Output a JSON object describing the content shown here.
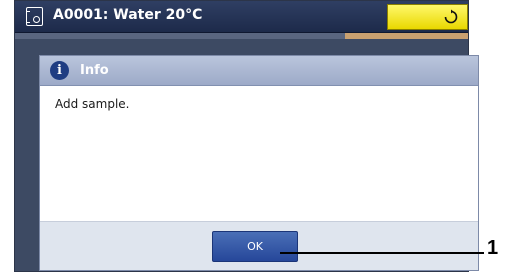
{
  "title_bar": {
    "title": "A0001: Water 20°C",
    "method_icon": "method-icon",
    "refresh_icon": "refresh-icon",
    "status_color": "#f2e400"
  },
  "dialog": {
    "title": "Info",
    "icon": "info-icon",
    "message": "Add sample.",
    "ok_label": "OK"
  },
  "callout": {
    "label": "1"
  }
}
